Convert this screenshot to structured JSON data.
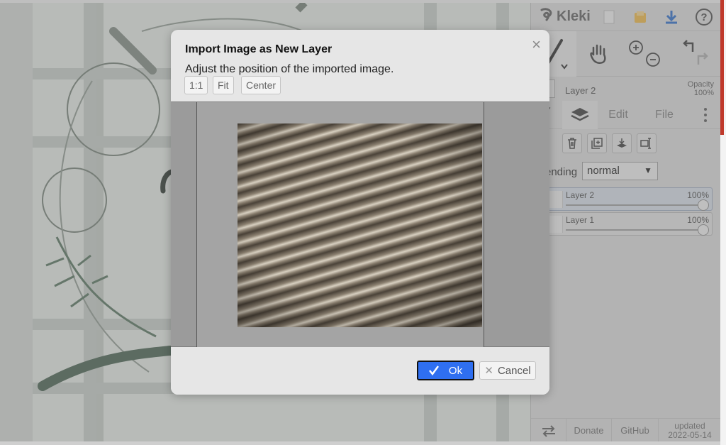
{
  "app": {
    "brand": "Kleki",
    "icons": [
      "kleki-logo-icon",
      "new-image-icon",
      "save-icon",
      "download-icon",
      "help-icon"
    ]
  },
  "panel": {
    "current_layer_name": "Layer 2",
    "opacity_label": "Opacity",
    "opacity_value": "100%",
    "tabs": {
      "edit": "Edit",
      "file": "File"
    },
    "blending_label": "ending",
    "blending_value": "normal",
    "layers": [
      {
        "name": "Layer 2",
        "opacity": "100%",
        "selected": true
      },
      {
        "name": "Layer 1",
        "opacity": "100%",
        "selected": false
      }
    ],
    "footer": {
      "donate": "Donate",
      "github": "GitHub",
      "updated_label": "updated",
      "updated_date": "2022-05-14"
    }
  },
  "dialog": {
    "title": "Import Image as New Layer",
    "description": "Adjust the position of the imported image.",
    "buttons": {
      "one_to_one": "1:1",
      "fit": "Fit",
      "center": "Center"
    },
    "ok": "Ok",
    "cancel": "Cancel",
    "close": "×",
    "ok_color": "#2f6ff0"
  }
}
